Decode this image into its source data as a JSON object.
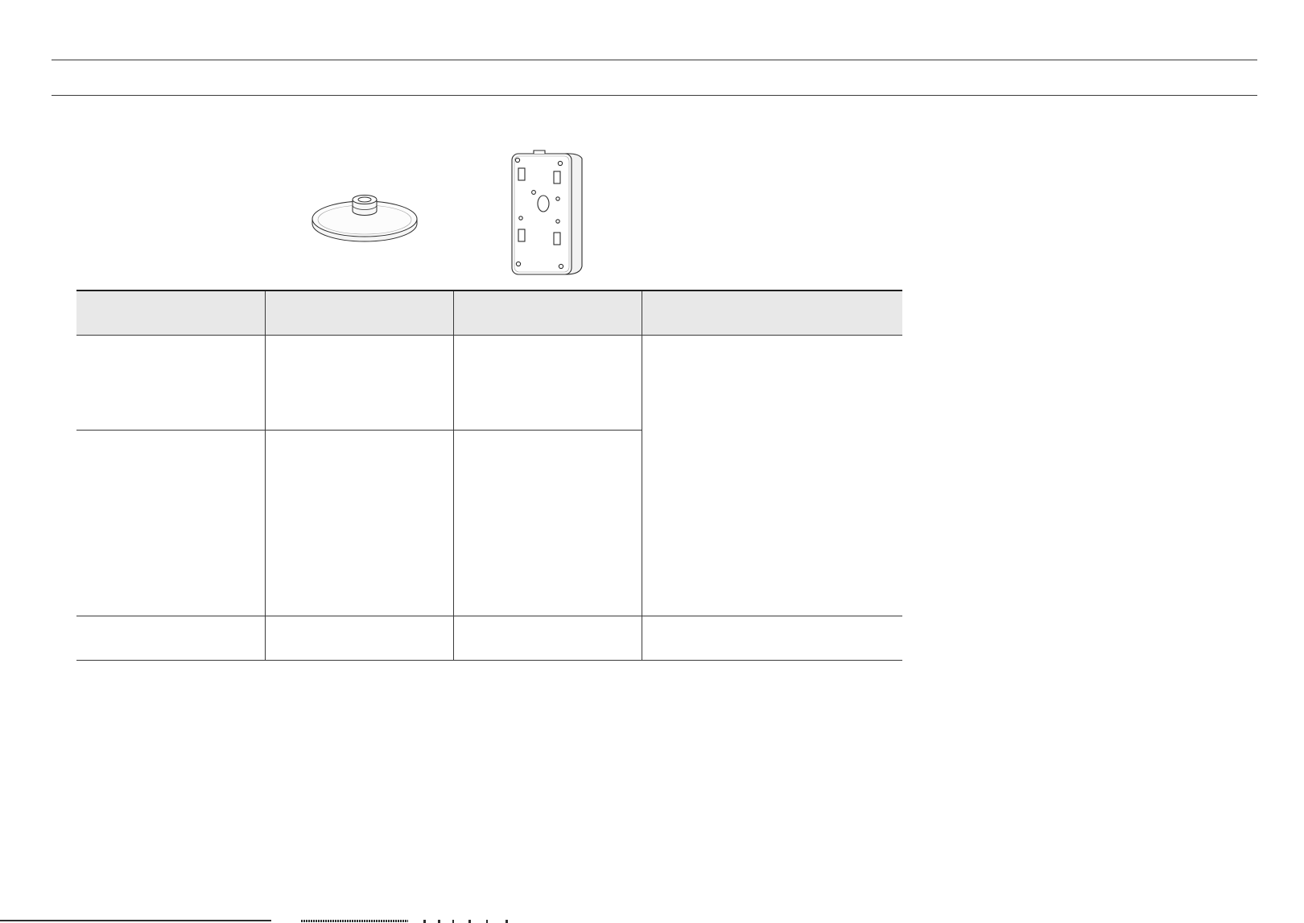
{
  "figures": {
    "left": {
      "icon": "disc-mount-icon"
    },
    "right": {
      "icon": "back-box-icon"
    }
  },
  "table": {
    "header": [
      "",
      "",
      "",
      ""
    ],
    "rows": [
      [
        "",
        "",
        ""
      ],
      [
        "",
        "",
        ""
      ],
      [
        "",
        "",
        "",
        ""
      ]
    ],
    "merged_cell": ""
  },
  "colors": {
    "rule": "#3a3a3a",
    "header_fill": "#e8e8e8"
  }
}
